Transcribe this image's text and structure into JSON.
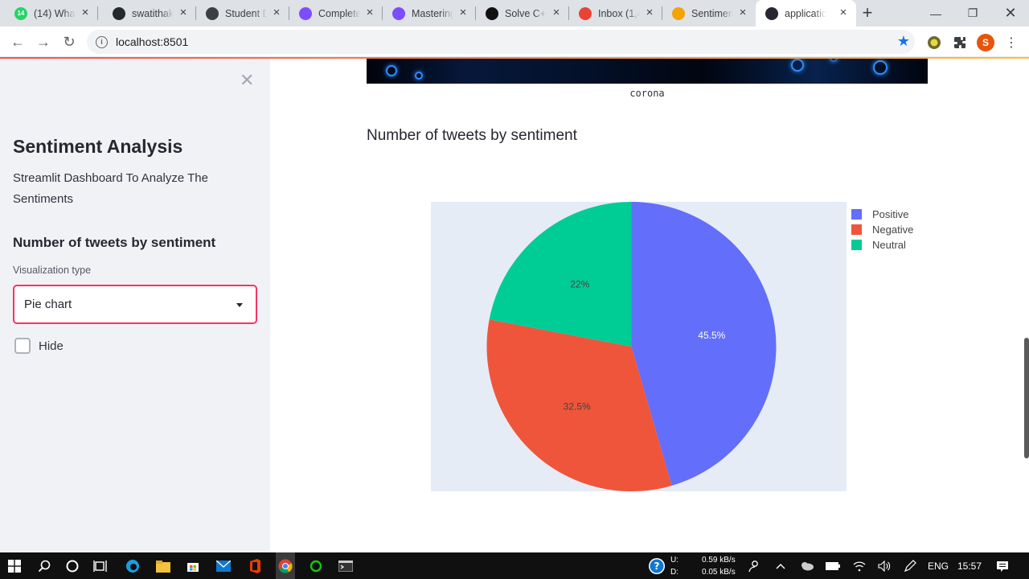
{
  "browser": {
    "tabs": [
      {
        "title": "(14) What",
        "badge": "14",
        "color": "#25d366"
      },
      {
        "title": "swatithak",
        "color": "#24292e"
      },
      {
        "title": "Student D",
        "color": "#3c4043"
      },
      {
        "title": "Complete",
        "color": "#7c4dff"
      },
      {
        "title": "Mastering",
        "color": "#7c4dff"
      },
      {
        "title": "Solve C++",
        "color": "#111111"
      },
      {
        "title": "Inbox (1,4",
        "color": "#ea4335"
      },
      {
        "title": "Sentimen",
        "color": "#f4a300"
      },
      {
        "title": "applicatio",
        "color": "#262730"
      }
    ],
    "url": "localhost:8501",
    "profile_initial": "S"
  },
  "sidebar": {
    "title": "Sentiment Analysis",
    "description": "Streamlit Dashboard To Analyze The Sentiments",
    "subheader": "Number of tweets by sentiment",
    "select_label": "Visualization type",
    "select_value": "Pie chart",
    "checkbox_label": "Hide"
  },
  "main": {
    "image_caption": "corona",
    "section_title": "Number of tweets by sentiment"
  },
  "chart_data": {
    "type": "pie",
    "categories": [
      "Positive",
      "Negative",
      "Neutral"
    ],
    "values": [
      45.5,
      32.5,
      22
    ],
    "labels": [
      "45.5%",
      "32.5%",
      "22%"
    ],
    "colors": [
      "#636efa",
      "#ef553b",
      "#00cc96"
    ],
    "legend": "top-right",
    "background": "#e5ecf6"
  },
  "taskbar": {
    "upload_label": "U:",
    "download_label": "D:",
    "upload_rate": "0.59 kB/s",
    "download_rate": "0.05 kB/s",
    "language": "ENG",
    "time": "15:57"
  }
}
